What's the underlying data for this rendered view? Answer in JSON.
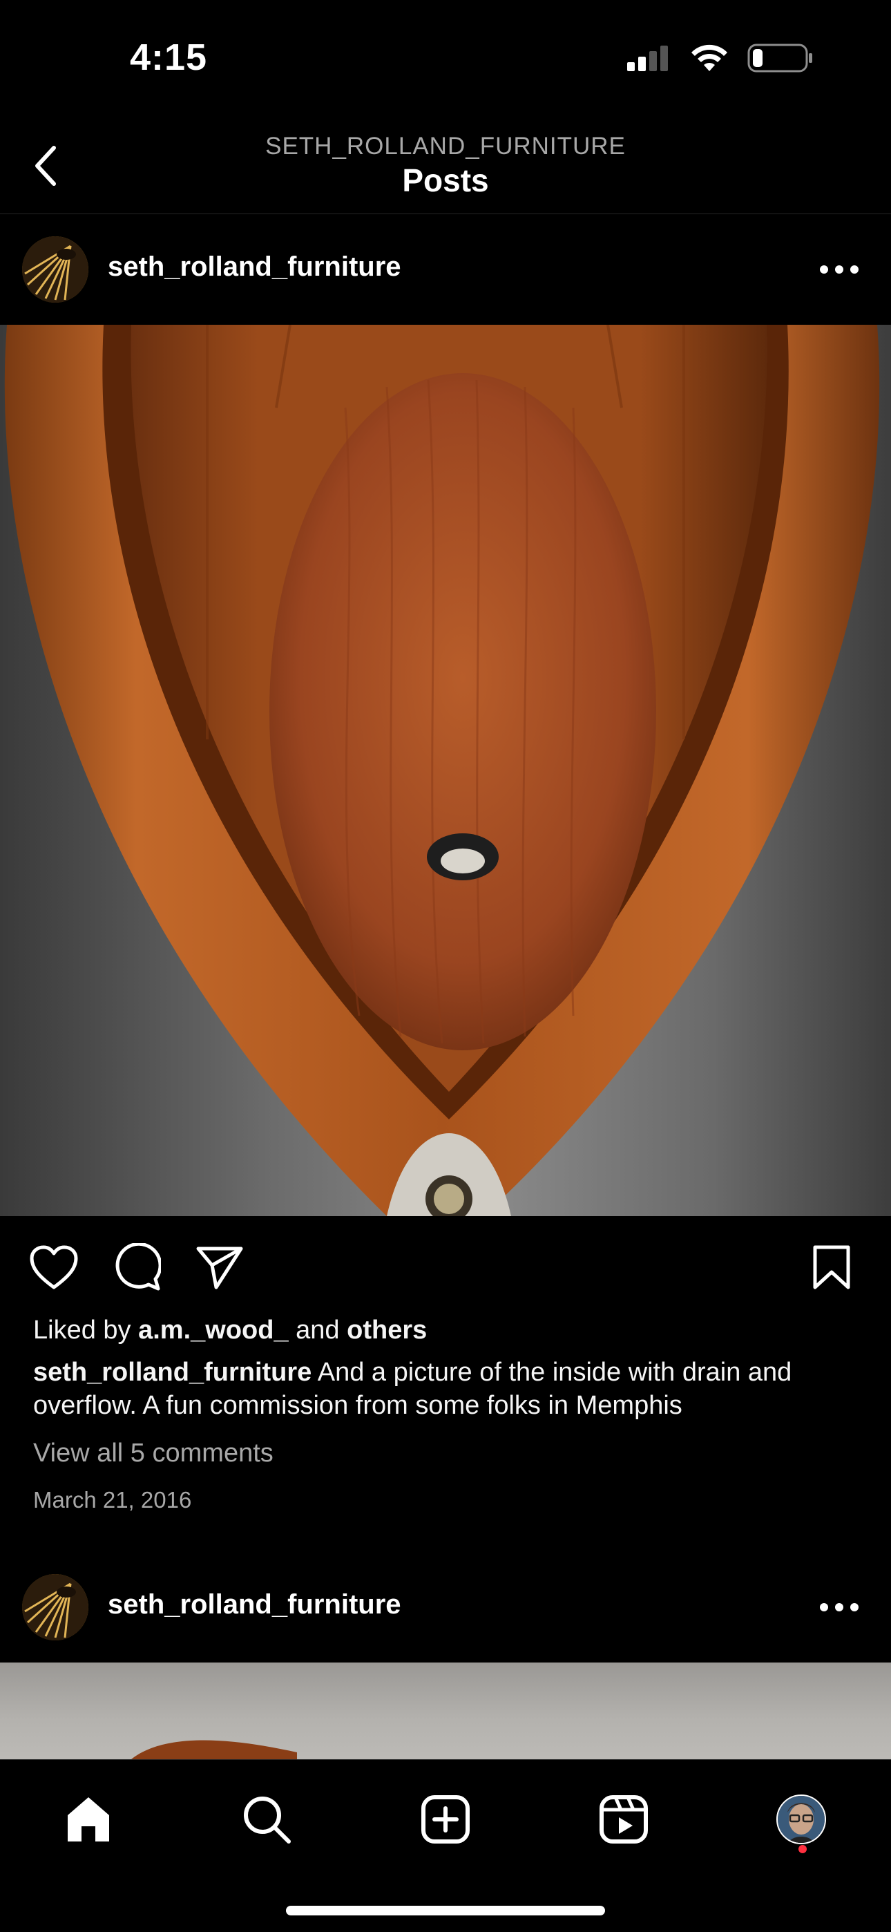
{
  "status_bar": {
    "time": "4:15"
  },
  "header": {
    "subtitle": "SETH_ROLLAND_FURNITURE",
    "title": "Posts"
  },
  "post": {
    "username": "seth_rolland_furniture",
    "liked_prefix": "Liked by ",
    "liked_user": "a.m._wood_",
    "liked_and": " and ",
    "liked_others": "others",
    "caption_user": "seth_rolland_furniture",
    "caption_text": " And a picture of the inside with drain and overflow. A fun commission from some folks in Memphis",
    "view_comments": "View all 5 comments",
    "date": "March 21, 2016"
  },
  "next_post": {
    "username": "seth_rolland_furniture"
  },
  "tabs": [
    {
      "icon": "home-icon"
    },
    {
      "icon": "search-icon"
    },
    {
      "icon": "create-icon"
    },
    {
      "icon": "reels-icon"
    },
    {
      "icon": "profile-avatar"
    }
  ],
  "colors": {
    "background": "#000000",
    "muted_text": "#a8a8a8",
    "notification_dot": "#ff3040"
  }
}
